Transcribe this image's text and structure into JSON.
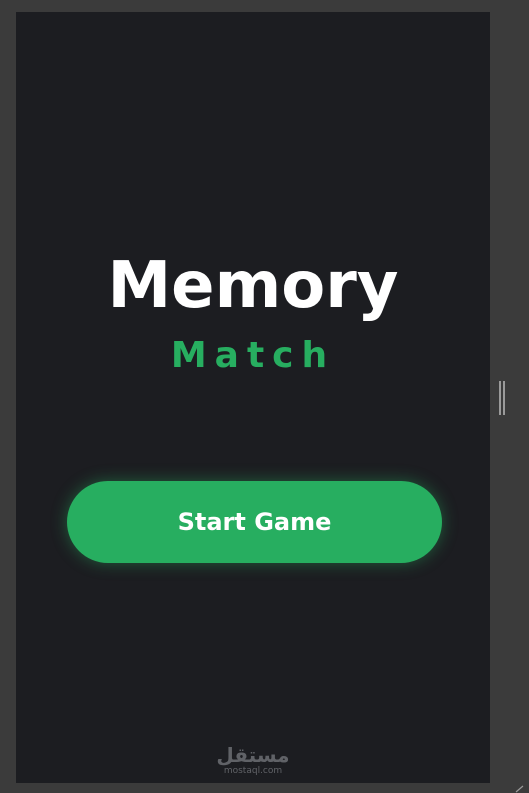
{
  "game": {
    "title": "Memory",
    "subtitle": "Match",
    "start_label": "Start Game"
  },
  "watermark": {
    "arabic": "مستقل",
    "latin": "mostaql.com"
  },
  "colors": {
    "background": "#1c1d21",
    "accent": "#27ae60",
    "title": "#ffffff"
  },
  "icons": {
    "scroll_handle": "drag-handle-icon",
    "resize": "resize-corner-icon"
  }
}
